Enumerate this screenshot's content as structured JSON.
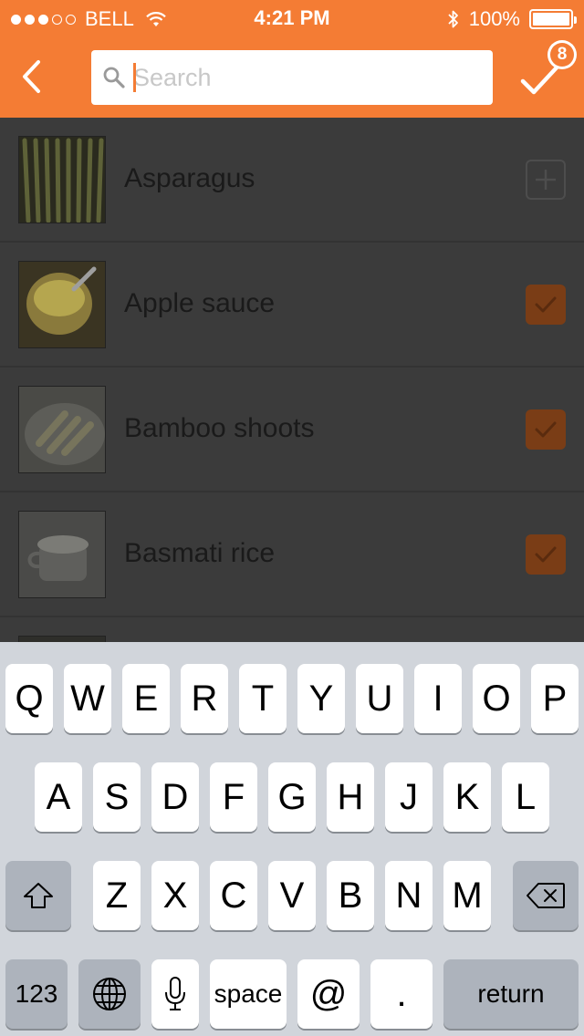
{
  "status_bar": {
    "carrier": "BELL",
    "time": "4:21 PM",
    "battery": "100%",
    "battery_level": 1.0,
    "signal_bars": 3,
    "signal_max": 5
  },
  "nav": {
    "search_placeholder": "Search",
    "search_value": "",
    "selected_count": "8"
  },
  "colors": {
    "accent": "#f47c34",
    "list_bg": "#3b3b3b",
    "checked_bg": "#7a3d16",
    "keyboard_bg": "#d1d5db"
  },
  "items": [
    {
      "label": "Asparagus",
      "state": "add",
      "icon": "plus-icon"
    },
    {
      "label": "Apple sauce",
      "state": "checked",
      "icon": "check-icon"
    },
    {
      "label": "Bamboo shoots",
      "state": "checked",
      "icon": "check-icon"
    },
    {
      "label": "Basmati rice",
      "state": "checked",
      "icon": "check-icon"
    }
  ],
  "keyboard": {
    "row1": [
      "Q",
      "W",
      "E",
      "R",
      "T",
      "Y",
      "U",
      "I",
      "O",
      "P"
    ],
    "row2": [
      "A",
      "S",
      "D",
      "F",
      "G",
      "H",
      "J",
      "K",
      "L"
    ],
    "row3": [
      "Z",
      "X",
      "C",
      "V",
      "B",
      "N",
      "M"
    ],
    "numbers_label": "123",
    "space_label": "space",
    "at_label": "@",
    "period_label": ".",
    "return_label": "return"
  }
}
